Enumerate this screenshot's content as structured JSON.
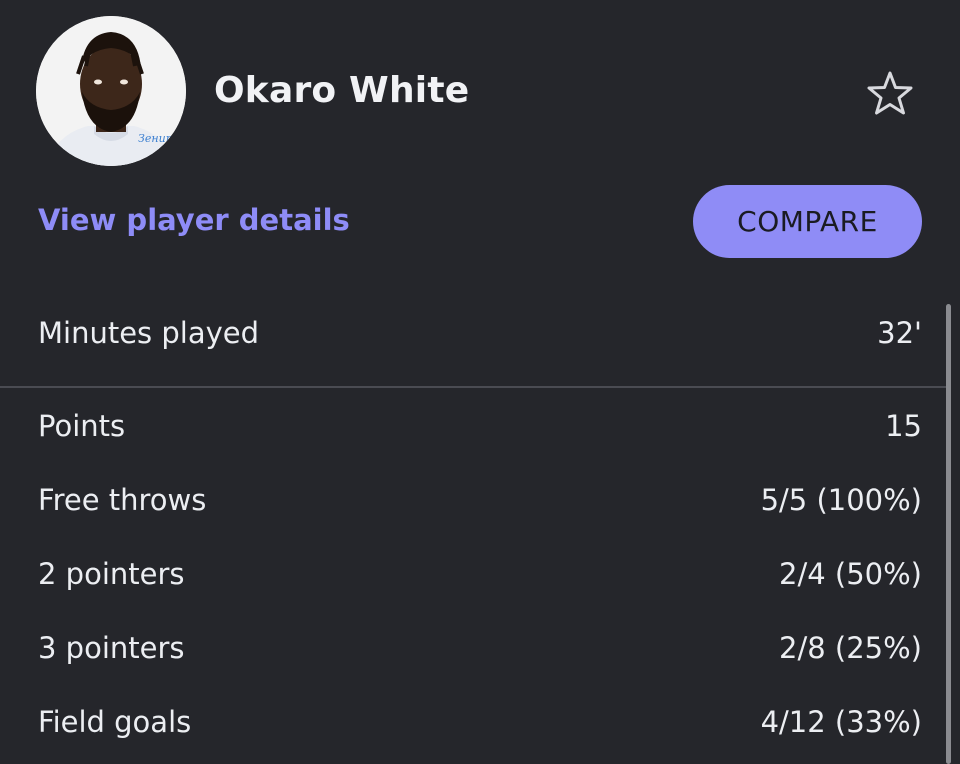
{
  "player": {
    "name": "Okaro White",
    "avatar_icon": "player-photo"
  },
  "favorite": {
    "icon": "star-outline-icon"
  },
  "links": {
    "details_label": "View player details"
  },
  "actions": {
    "compare_label": "COMPARE"
  },
  "colors": {
    "background": "#25262b",
    "accent": "#8f8cf6",
    "link": "#8e8cf7",
    "text": "#eceef2",
    "divider": "#4a4b52"
  },
  "minutes": {
    "label": "Minutes played",
    "value": "32'"
  },
  "stats": [
    {
      "label": "Points",
      "value": "15"
    },
    {
      "label": "Free throws",
      "value": "5/5 (100%)"
    },
    {
      "label": "2 pointers",
      "value": "2/4 (50%)"
    },
    {
      "label": "3 pointers",
      "value": "2/8 (25%)"
    },
    {
      "label": "Field goals",
      "value": "4/12 (33%)"
    }
  ]
}
